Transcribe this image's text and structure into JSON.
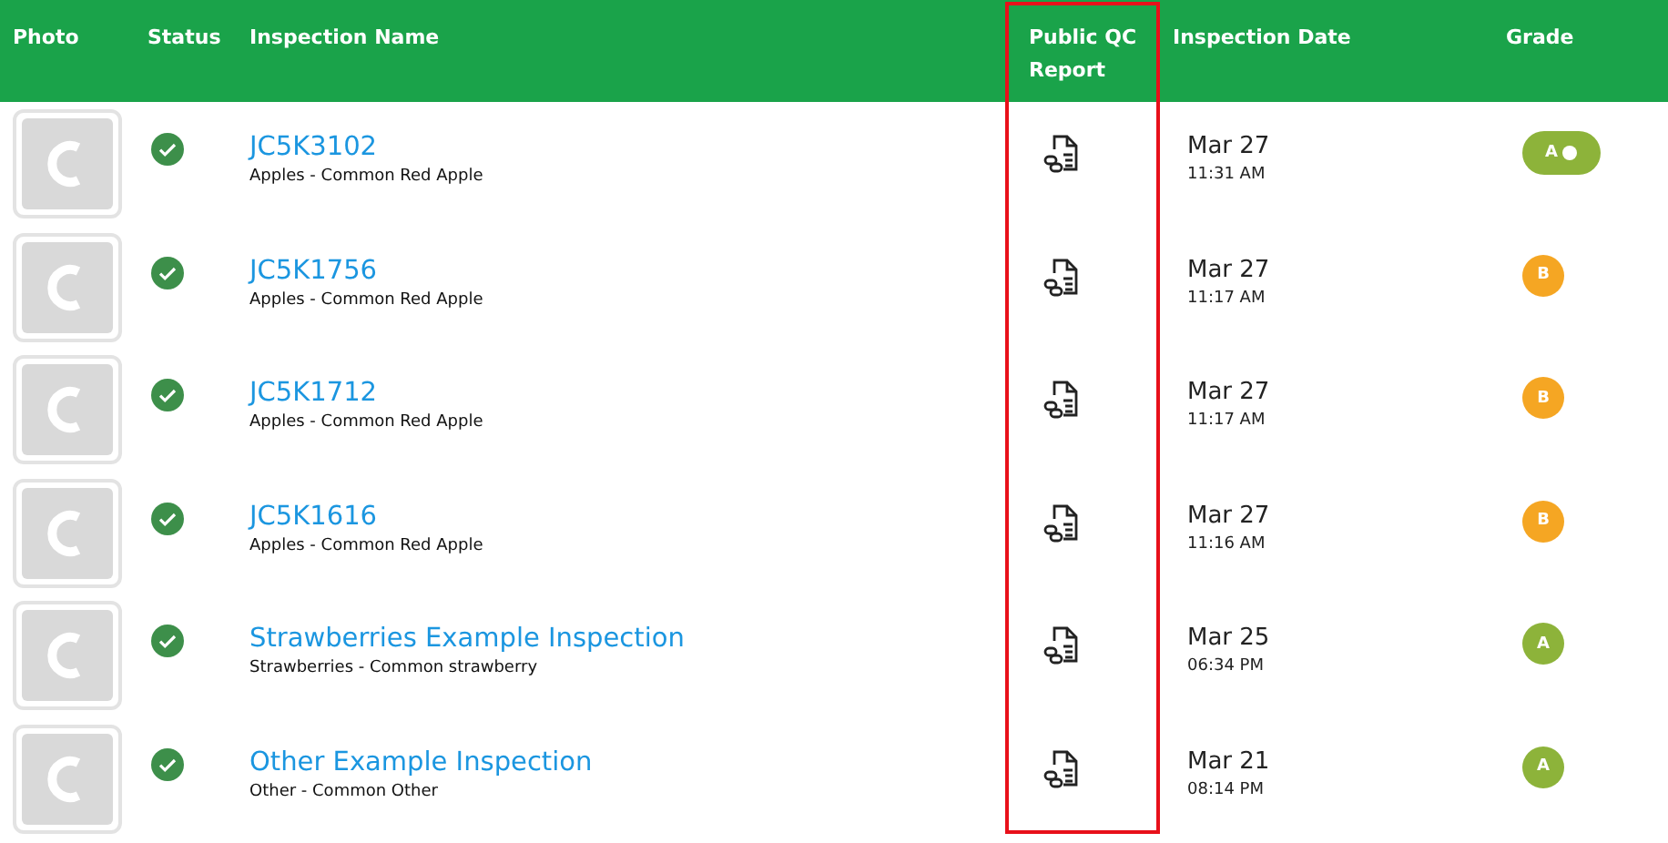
{
  "table": {
    "columns": [
      {
        "label": "Photo"
      },
      {
        "label": "Status"
      },
      {
        "label": "Inspection Name"
      },
      {
        "label": "Public QC Report",
        "highlighted": true
      },
      {
        "label": "Inspection Date"
      },
      {
        "label": "Grade"
      }
    ],
    "rows": [
      {
        "complete": true,
        "name": "JC5K3102",
        "product": "Apples - Common Red Apple",
        "date": "Mar 27",
        "time": "11:31 AM",
        "grade": {
          "label": "A",
          "kind": "toggle",
          "color": "#8db33a"
        }
      },
      {
        "complete": true,
        "name": "JC5K1756",
        "product": "Apples - Common Red Apple",
        "date": "Mar 27",
        "time": "11:17 AM",
        "grade": {
          "label": "B",
          "kind": "dot",
          "color": "#f5a623"
        }
      },
      {
        "complete": true,
        "name": "JC5K1712",
        "product": "Apples - Common Red Apple",
        "date": "Mar 27",
        "time": "11:17 AM",
        "grade": {
          "label": "B",
          "kind": "dot",
          "color": "#f5a623"
        }
      },
      {
        "complete": true,
        "name": "JC5K1616",
        "product": "Apples - Common Red Apple",
        "date": "Mar 27",
        "time": "11:16 AM",
        "grade": {
          "label": "B",
          "kind": "dot",
          "color": "#f5a623"
        }
      },
      {
        "complete": true,
        "name": "Strawberries Example Inspection",
        "product": "Strawberries - Common strawberry",
        "date": "Mar 25",
        "time": "06:34 PM",
        "grade": {
          "label": "A",
          "kind": "dot",
          "color": "#8db33a"
        }
      },
      {
        "complete": true,
        "name": "Other Example Inspection",
        "product": "Other - Common Other",
        "date": "Mar 21",
        "time": "08:14 PM",
        "grade": {
          "label": "A",
          "kind": "dot",
          "color": "#8db33a"
        }
      }
    ]
  }
}
